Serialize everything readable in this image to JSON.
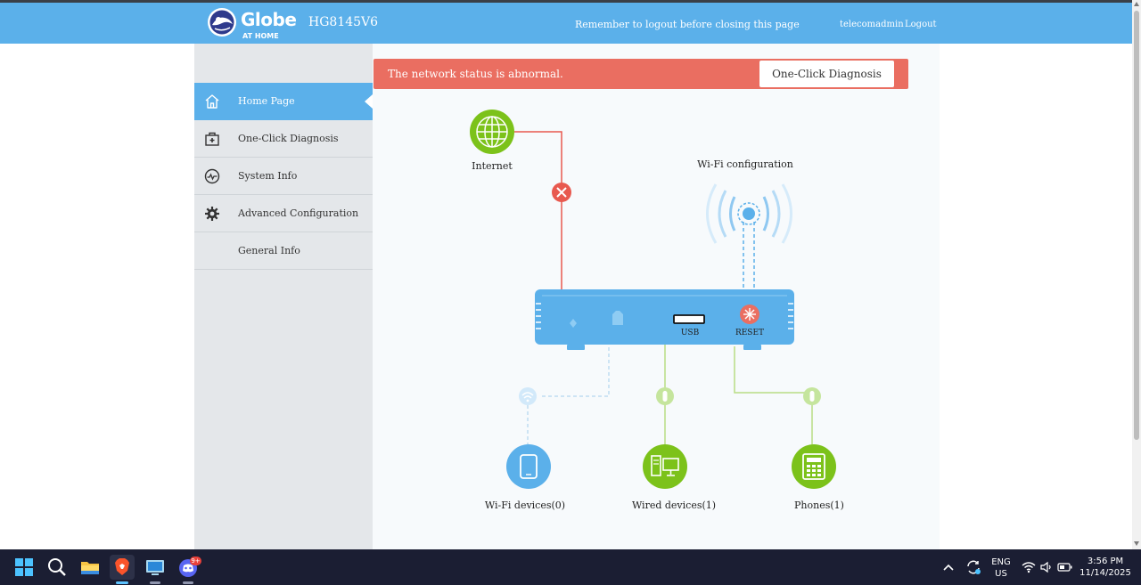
{
  "header": {
    "brand": "Globe",
    "brand_sub": "AT HOME",
    "model": "HG8145V6",
    "reminder": "Remember to logout before closing this page",
    "username": "telecomadmin",
    "logout": "Logout"
  },
  "sidebar": {
    "items": [
      {
        "label": "Home Page",
        "icon": "home-icon",
        "active": true
      },
      {
        "label": "One-Click Diagnosis",
        "icon": "diagnosis-kit-icon",
        "active": false
      },
      {
        "label": "System Info",
        "icon": "pulse-icon",
        "active": false
      },
      {
        "label": "Advanced Configuration",
        "icon": "gear-icon",
        "active": false
      },
      {
        "label": "General Info",
        "icon": "",
        "active": false
      }
    ]
  },
  "alert": {
    "message": "The network status is abnormal.",
    "button": "One-Click Diagnosis"
  },
  "diagram": {
    "internet_label": "Internet",
    "wifi_config_label": "Wi-Fi configuration",
    "usb_label": "USB",
    "reset_label": "RESET",
    "wifi_devices_label": "Wi-Fi devices(0)",
    "wired_devices_label": "Wired devices(1)",
    "phones_label": "Phones(1)"
  },
  "taskbar": {
    "apps": [
      "start-icon",
      "search-icon",
      "file-explorer-icon",
      "brave-browser-icon",
      "remote-desktop-icon",
      "discord-icon"
    ],
    "discord_badge": "9+",
    "lang_line1": "ENG",
    "lang_line2": "US",
    "time": "3:56 PM",
    "date": "11/14/2025"
  },
  "colors": {
    "header_blue": "#5bb0ea",
    "alert_red": "#ea6e61",
    "internet_green": "#7cc21a",
    "error_red": "#e8594f",
    "sidebar_bg": "#e4e7ea"
  }
}
